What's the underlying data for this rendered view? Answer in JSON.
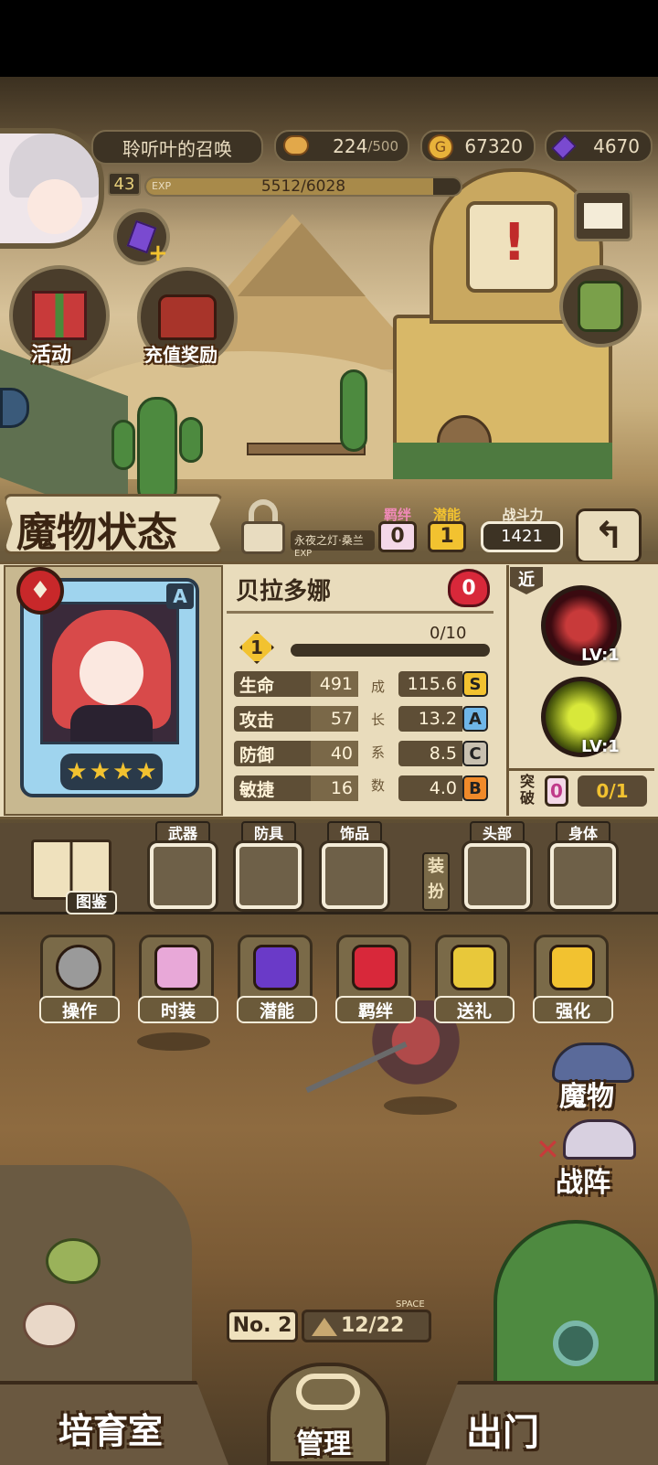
{
  "header": {
    "name_label": "聆听叶的召唤",
    "level": "43",
    "exp_tag": "EXP",
    "exp_text": "5512/6028",
    "exp_fraction": 0.914,
    "stamina": "224",
    "stamina_max": "/500",
    "gold": "67320",
    "gems": "4670"
  },
  "left_buttons": {
    "activity": "活动",
    "recharge": "充值奖励"
  },
  "status": {
    "title": "魔物状态",
    "stage_text": "永夜之灯·桑兰",
    "stage_exp_tag": "EXP",
    "bond_label": "羁绊",
    "bond_value": "0",
    "potential_label": "潜能",
    "potential_value": "1",
    "power_label": "战斗力",
    "power_value": "1421"
  },
  "monster": {
    "name": "贝拉多娜",
    "heart_value": "0",
    "rank_badge": "A",
    "level_badge": "1",
    "progress_text": "0/10",
    "progress_fraction": 0,
    "stars": 4,
    "stats": [
      {
        "name": "生命",
        "value": "491",
        "growth": "115.6",
        "grade": "S",
        "grade_color": "#f2c230"
      },
      {
        "name": "攻击",
        "value": "57",
        "growth": "13.2",
        "grade": "A",
        "grade_color": "#6fb6e8"
      },
      {
        "name": "防御",
        "value": "40",
        "growth": "8.5",
        "grade": "C",
        "grade_color": "#c8c0b0"
      },
      {
        "name": "敏捷",
        "value": "16",
        "growth": "4.0",
        "grade": "B",
        "grade_color": "#f08a2a"
      }
    ],
    "growth_chars": [
      "成",
      "长",
      "系",
      "数"
    ]
  },
  "skills": {
    "range_tag": "近",
    "skill1_level": "LV:1",
    "skill2_level": "LV:1",
    "breakthrough_label_1": "突",
    "breakthrough_label_2": "破",
    "breakthrough_count": "0",
    "breakthrough_progress": "0/1"
  },
  "equipment": {
    "album_label": "图鉴",
    "weapon": "武器",
    "armor": "防具",
    "accessory": "饰品",
    "equip_label_1": "装",
    "equip_label_2": "扮",
    "head": "头部",
    "body": "身体"
  },
  "actions": [
    "操作",
    "时装",
    "潜能",
    "羁绊",
    "送礼",
    "强化"
  ],
  "right_nav": {
    "monsters": "魔物",
    "formation": "战阵"
  },
  "bottom": {
    "room_no": "No. 2",
    "space_tag": "SPACE",
    "capacity": "12/22",
    "nursery": "培育室",
    "manage": "管理",
    "go_out": "出门"
  }
}
